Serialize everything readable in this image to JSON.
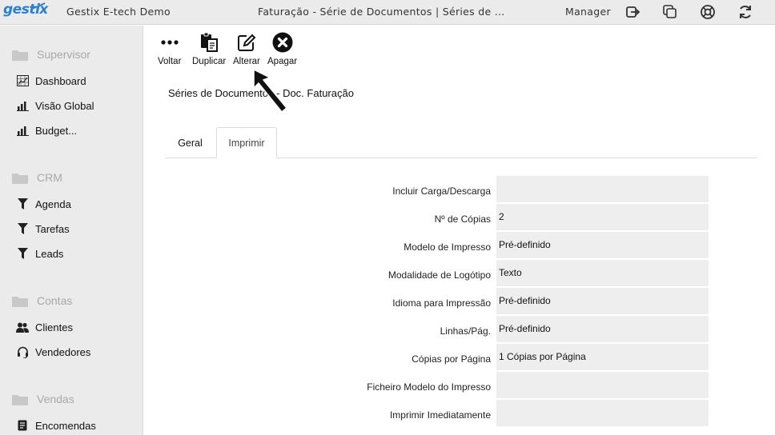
{
  "app": {
    "logo_text": "gestix",
    "company": "Gestix E-tech Demo",
    "window_title": "Faturação - Série de Documentos | Séries de ...",
    "user": "Manager"
  },
  "top_icons": [
    "logout-icon",
    "windows-icon",
    "help-lifebuoy-icon",
    "refresh-icon"
  ],
  "sidebar": {
    "sections": [
      {
        "title": "Supervisor",
        "items": [
          {
            "label": "Dashboard",
            "icon": "dashboard-icon"
          },
          {
            "label": "Visão Global",
            "icon": "bar-chart-icon"
          },
          {
            "label": "Budget...",
            "icon": "bar-chart-icon"
          }
        ]
      },
      {
        "title": "CRM",
        "items": [
          {
            "label": "Agenda",
            "icon": "filter-icon"
          },
          {
            "label": "Tarefas",
            "icon": "filter-icon"
          },
          {
            "label": "Leads",
            "icon": "filter-icon"
          }
        ]
      },
      {
        "title": "Contas",
        "items": [
          {
            "label": "Clientes",
            "icon": "users-icon"
          },
          {
            "label": "Vendedores",
            "icon": "headset-icon"
          }
        ]
      },
      {
        "title": "Vendas",
        "items": [
          {
            "label": "Encomendas",
            "icon": "document-icon"
          }
        ]
      }
    ]
  },
  "toolbar": {
    "back_label": "Voltar",
    "duplicate_label": "Duplicar",
    "edit_label": "Alterar",
    "delete_label": "Apagar"
  },
  "page_heading": "Séries de Documentos - Doc. Faturação",
  "tabs": [
    {
      "label": "Geral",
      "active": false
    },
    {
      "label": "Imprimir",
      "active": true
    }
  ],
  "form": {
    "fields": [
      {
        "label": "Incluir Carga/Descarga",
        "value": ""
      },
      {
        "label": "Nº de Cópias",
        "value": "2"
      },
      {
        "label": "Modelo de Impresso",
        "value": "Pré-definido"
      },
      {
        "label": "Modalidade de Logótipo",
        "value": "Texto"
      },
      {
        "label": "Idioma para Impressão",
        "value": "Pré-definido"
      },
      {
        "label": "Linhas/Pág.",
        "value": "Pré-definido"
      },
      {
        "label": "Cópias por Página",
        "value": "1 Cópias por Página"
      },
      {
        "label": "Ficheiro Modelo do Impresso",
        "value": ""
      },
      {
        "label": "Imprimir Imediatamente",
        "value": ""
      }
    ]
  },
  "colors": {
    "accent": "#2b7fd1",
    "sidebar_bg": "#ebebeb",
    "field_bg": "#eeeeee",
    "section_muted": "#a8a8a8"
  }
}
